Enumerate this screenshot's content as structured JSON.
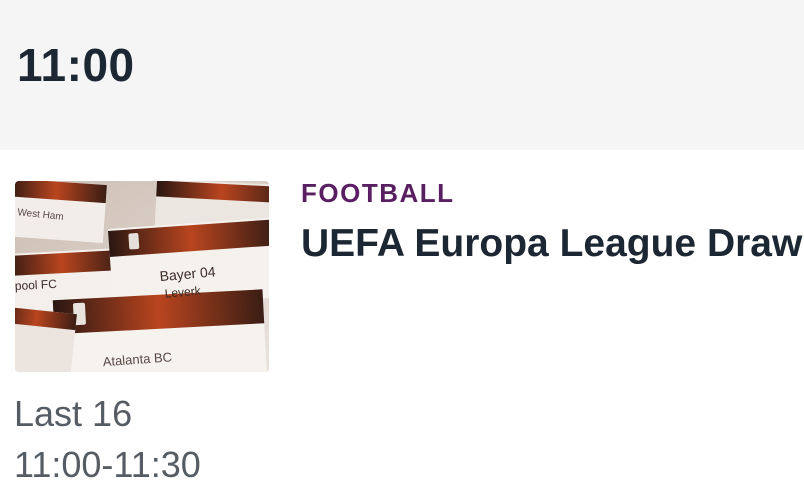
{
  "header": {
    "time": "11:00"
  },
  "program": {
    "category": "FOOTBALL",
    "title": "UEFA Europa League Draw",
    "subtitle": "Last 16",
    "time_range": "11:00-11:30",
    "thumbnail": {
      "labels": [
        "West Ham",
        "Bayer 04",
        "pool FC",
        "Leverk",
        "Atalanta BC"
      ]
    }
  },
  "colors": {
    "category": "#5a1f62",
    "header_bg": "#f5f5f5",
    "text": "#1d2733",
    "muted": "#555c63"
  }
}
